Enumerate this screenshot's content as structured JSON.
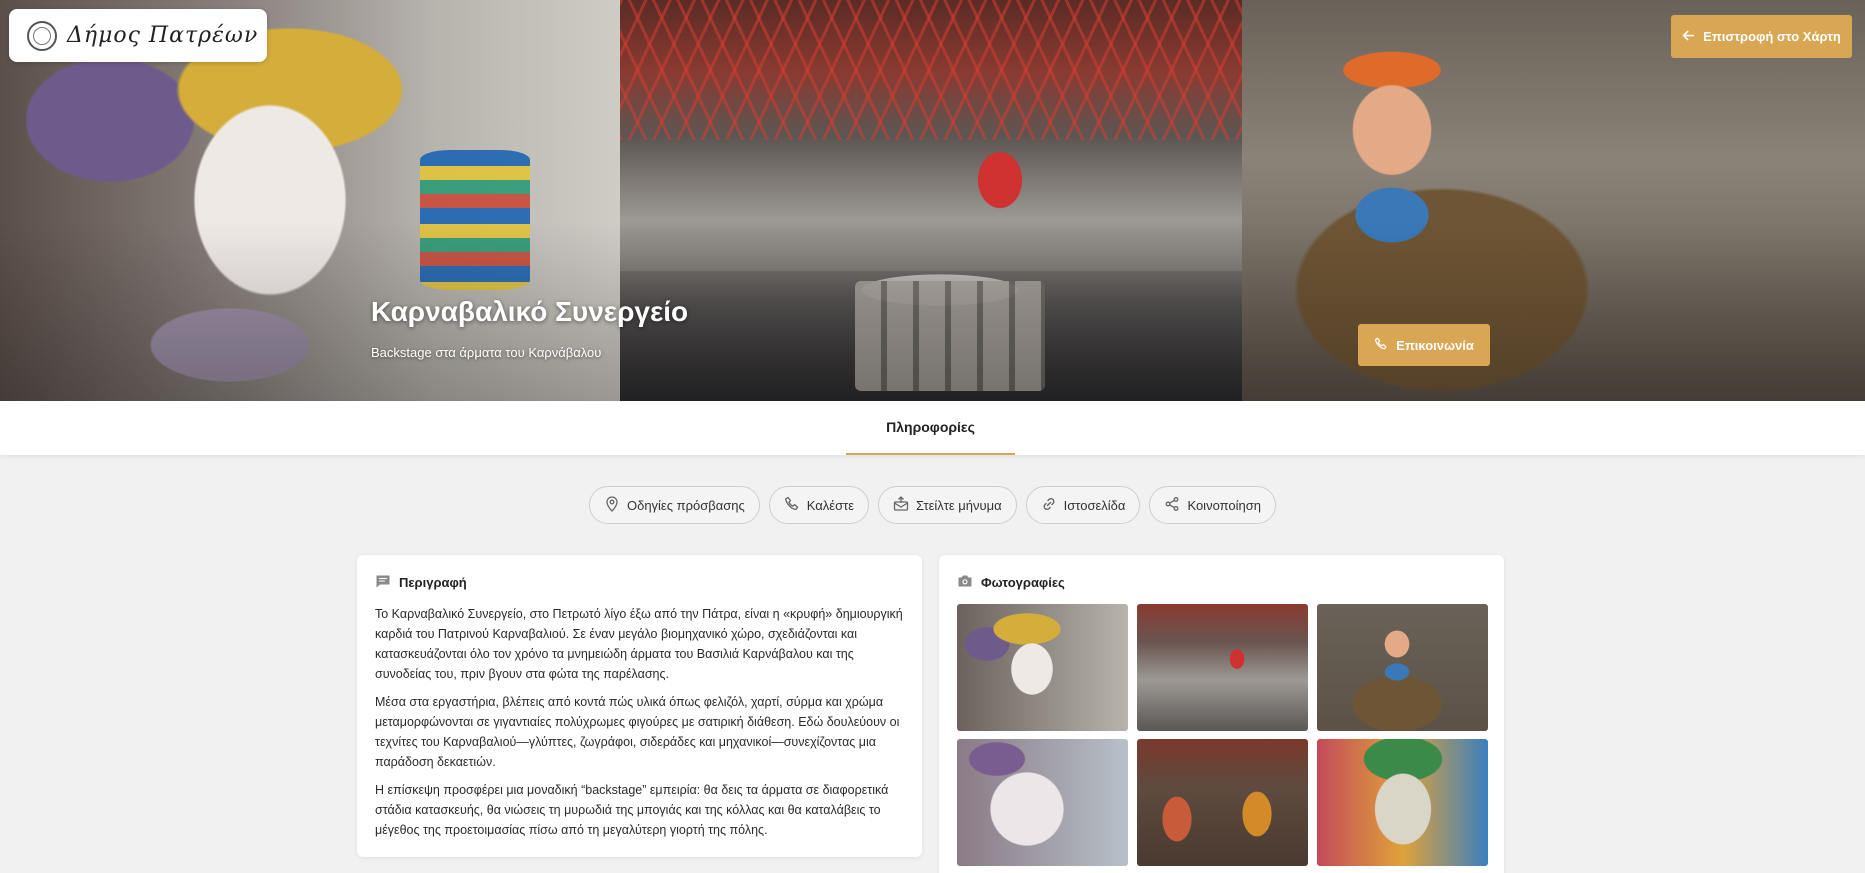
{
  "brand": {
    "logo_text": "Δήμος Πατρέων"
  },
  "hero": {
    "title": "Καρναβαλικό Συνεργείο",
    "subtitle": "Backstage στα άρματα του Καρνάβαλου",
    "back_label": "Επιστροφή στο Χάρτη",
    "contact_label": "Επικοινωνία"
  },
  "tabs": [
    {
      "label": "Πληροφορίες",
      "active": true
    }
  ],
  "actions": [
    {
      "label": "Οδηγίες πρόσβασης",
      "icon": "map-pin-icon"
    },
    {
      "label": "Καλέστε",
      "icon": "phone-icon"
    },
    {
      "label": "Στείλτε μήνυμα",
      "icon": "mail-icon"
    },
    {
      "label": "Ιστοσελίδα",
      "icon": "link-icon"
    },
    {
      "label": "Κοινοποίηση",
      "icon": "share-icon"
    }
  ],
  "description": {
    "heading": "Περιγραφή",
    "paragraphs": [
      "Το Καρναβαλικό Συνεργείο, στο Πετρωτό λίγο έξω από την Πάτρα, είναι η «κρυφή» δημιουργική καρδιά του Πατρινού Καρναβαλιού. Σε έναν μεγάλο βιομηχανικό χώρο, σχεδιάζονται και κατασκευάζονται όλο τον χρόνο τα μνημειώδη άρματα του Βασιλιά Καρνάβαλου και της συνοδείας του, πριν βγουν στα φώτα της παρέλασης.",
      "Μέσα στα εργαστήρια, βλέπεις από κοντά πώς υλικά όπως φελιζόλ, χαρτί, σύρμα και χρώμα μεταμορφώνονται σε γιγαντιαίες πολύχρωμες φιγούρες με σατιρική διάθεση. Εδώ δουλεύουν οι τεχνίτες του Καρναβαλιού—γλύπτες, ζωγράφοι, σιδεράδες και μηχανικοί—συνεχίζοντας μια παράδοση δεκαετιών.",
      "Η επίσκεψη προσφέρει μια μοναδική “backstage” εμπειρία: θα δεις τα άρματα σε διαφορετικά στάδια κατασκευής, θα νιώσεις τη μυρωδιά της μπογιάς και της κόλλας και θα καταλάβεις το μέγεθος της προετοιμασίας πίσω από τη μεγαλύτερη γιορτή της πόλης."
    ]
  },
  "photos": {
    "heading": "Φωτογραφίες",
    "items": [
      "jester-head-photo",
      "workshop-hall-photo",
      "bird-sculpture-photo",
      "clown-face-photo",
      "figures-row-photo",
      "mask-face-photo"
    ]
  },
  "colors": {
    "accent": "#d9a653",
    "background": "#f1f1f1"
  }
}
